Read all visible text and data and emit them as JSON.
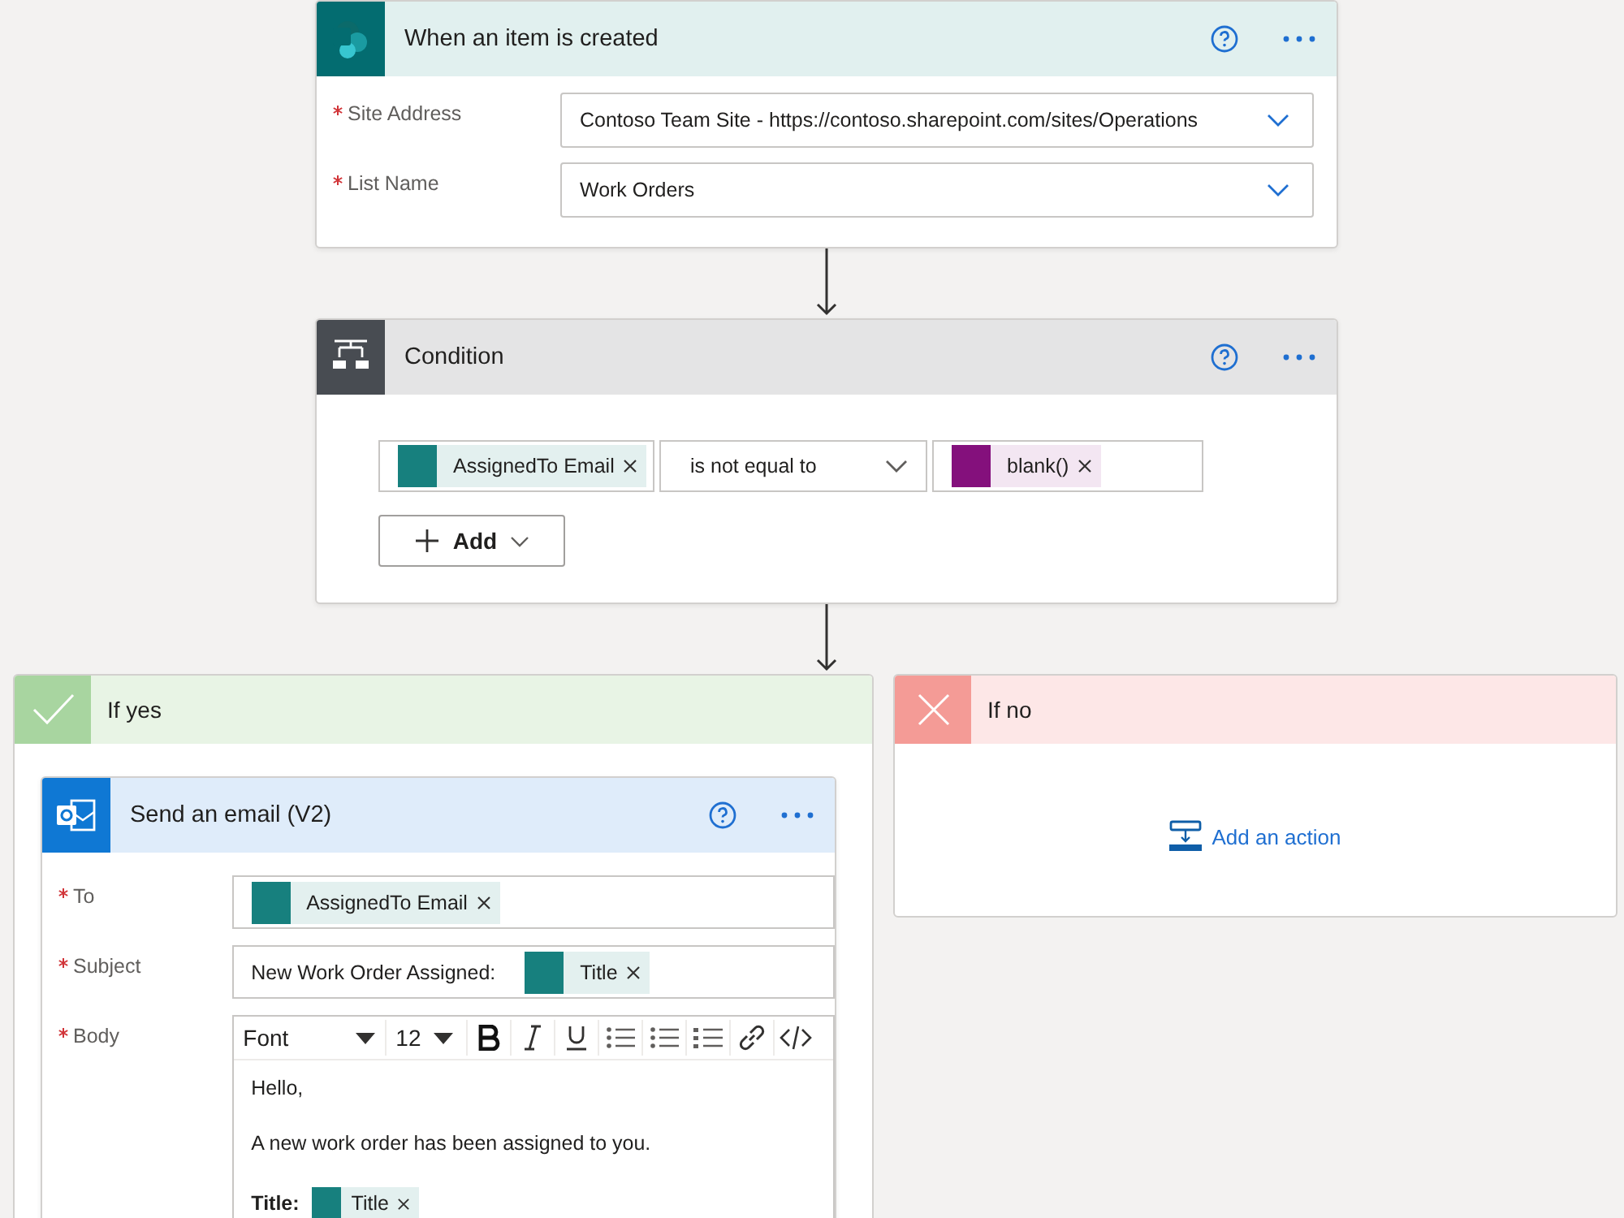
{
  "trigger": {
    "title": "When an item is created",
    "fields": [
      {
        "label": "Site Address",
        "required": true,
        "value": "Contoso Team Site - https://contoso.sharepoint.com/sites/Operations"
      },
      {
        "label": "List Name",
        "required": true,
        "value": "Work Orders"
      }
    ]
  },
  "condition": {
    "title": "Condition",
    "left_token": {
      "label": "AssignedTo Email",
      "kind": "sharepoint"
    },
    "operator": "is not equal to",
    "right_token": {
      "label": "blank()",
      "kind": "expression"
    },
    "add_button": "Add"
  },
  "yes_branch": {
    "title": "If yes",
    "action": {
      "title": "Send an email (V2)",
      "fields": [
        {
          "kind": "tokens",
          "label": "To",
          "required": true,
          "parts": [
            {
              "kind": "sharepoint",
              "label": "AssignedTo Email"
            }
          ]
        },
        {
          "kind": "tokens",
          "label": "Subject",
          "required": true,
          "parts": [
            {
              "kind": "text",
              "text": "New Work Order Assigned:"
            },
            {
              "kind": "sharepoint",
              "label": "Title"
            }
          ]
        },
        {
          "kind": "editor",
          "label": "Body",
          "required": true,
          "font": "Font",
          "size": "12",
          "lines": [
            {
              "kind": "text",
              "text": "Hello,"
            },
            {
              "kind": "text",
              "text": "A new work order has been assigned to you."
            },
            {
              "kind": "field",
              "label": "Title:",
              "token": {
                "label": "Title",
                "kind": "sharepoint"
              }
            }
          ]
        }
      ]
    }
  },
  "no_branch": {
    "title": "If no",
    "add_action": "Add an action"
  }
}
